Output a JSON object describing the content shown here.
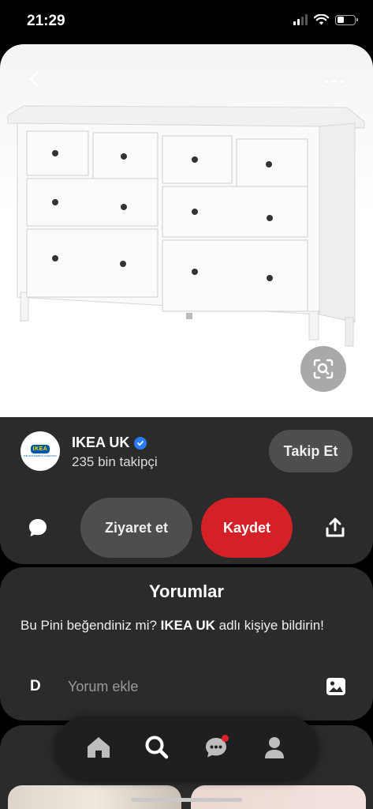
{
  "status_bar": {
    "time": "21:29",
    "icons": [
      "signal-icon",
      "wifi-icon",
      "battery-icon"
    ]
  },
  "pin": {
    "image_subject": "white-dresser-image",
    "icons": [
      "back-icon",
      "more-icon",
      "visual-search-icon"
    ]
  },
  "profile": {
    "name": "IKEA UK",
    "logo_text": "IKEA",
    "logo_subtext": "THE WONDERFUL EVERYDAY",
    "followers": "235 bin takipçi",
    "follow_label": "Takip Et",
    "verified": true
  },
  "actions": {
    "visit_label": "Ziyaret et",
    "save_label": "Kaydet",
    "colors": {
      "save": "#d42027",
      "secondary": "#4e4e4e"
    }
  },
  "comments": {
    "title": "Yorumlar",
    "prompt_before": "Bu Pini beğendiniz mi? ",
    "prompt_name": "IKEA UK",
    "prompt_after": " adlı kişiye bildirin!",
    "user_initial": "D",
    "input_placeholder": "Yorum ekle"
  },
  "bottom_nav": {
    "items": [
      "home-icon",
      "search-icon",
      "messages-icon",
      "profile-icon"
    ],
    "active": "search-icon",
    "messages_has_notification": true
  }
}
